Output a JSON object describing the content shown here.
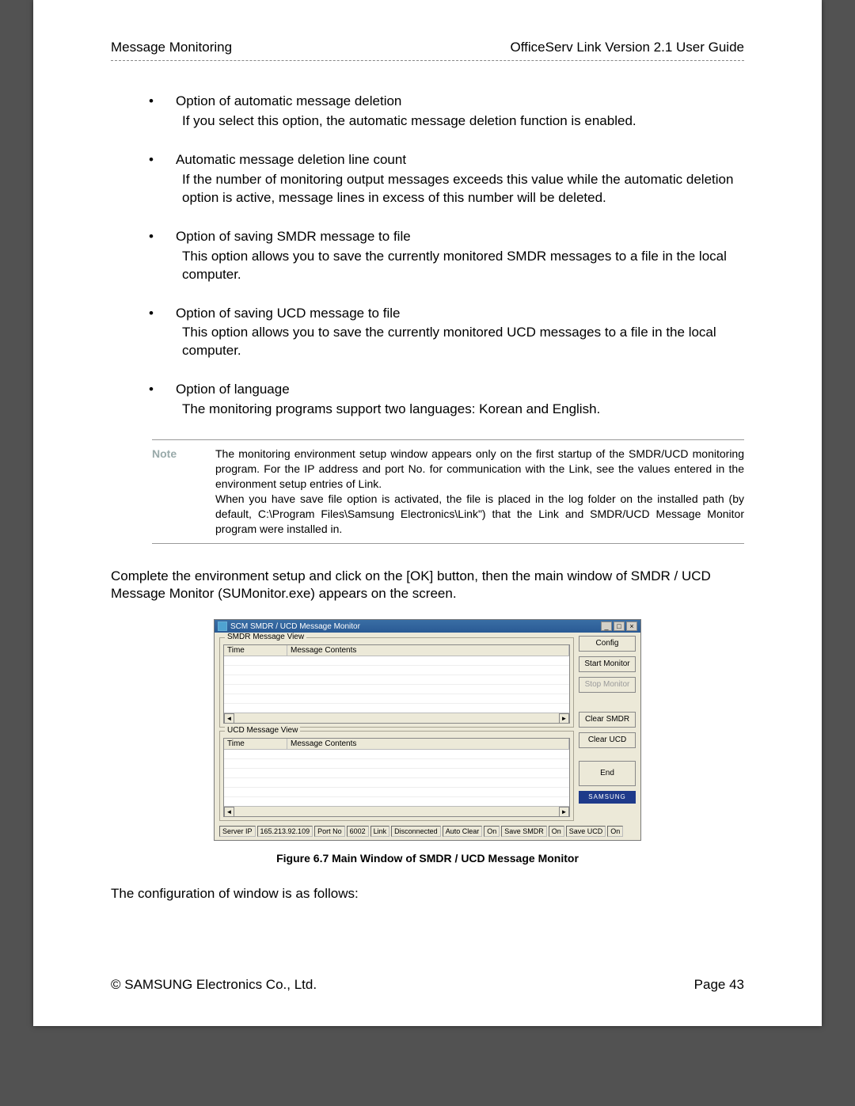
{
  "header": {
    "left": "Message Monitoring",
    "right": "OfficeServ Link Version 2.1 User Guide"
  },
  "bullets": [
    {
      "title": "Option of automatic message deletion",
      "desc": "If you select this option, the automatic message deletion function is enabled."
    },
    {
      "title": "Automatic message deletion line count",
      "desc": "If the number of monitoring output messages exceeds this value while the automatic deletion option is active, message lines in excess of this number will be deleted."
    },
    {
      "title": "Option of saving SMDR message to file",
      "desc": "This option allows you to save the currently monitored SMDR messages to a file in the local computer."
    },
    {
      "title": "Option of saving UCD message to file",
      "desc": "This option allows you to save the currently monitored UCD messages to a file in the local computer."
    },
    {
      "title": "Option of language",
      "desc": "The monitoring programs support two languages: Korean and English."
    }
  ],
  "note": {
    "label": "Note",
    "text": "The monitoring environment setup window appears only on the first startup of the SMDR/UCD monitoring program. For the IP address and port No. for communication with the Link, see the values entered in the environment setup entries of Link.\nWhen you have save file option is activated, the file is placed in the log folder on the installed path (by default, C:\\Program Files\\Samsung Electronics\\Link\") that the Link and SMDR/UCD Message Monitor program were installed in."
  },
  "para_after_note": "Complete the environment setup and click on the [OK] button, then the main window of SMDR / UCD Message Monitor (SUMonitor.exe) appears on the screen.",
  "screenshot": {
    "title": "SCM SMDR / UCD Message Monitor",
    "group_smdr": "SMDR Message View",
    "group_ucd": "UCD Message View",
    "col_time": "Time",
    "col_msg": "Message Contents",
    "buttons": {
      "config": "Config",
      "start": "Start Monitor",
      "stop": "Stop Monitor",
      "clear_smdr": "Clear SMDR",
      "clear_ucd": "Clear UCD",
      "end": "End"
    },
    "logo": "SAMSUNG",
    "status": {
      "server_ip_lbl": "Server IP",
      "server_ip": "165.213.92.109",
      "port_lbl": "Port No",
      "port": "6002",
      "link_lbl": "Link",
      "link": "Disconnected",
      "auto_lbl": "Auto Clear",
      "auto": "On",
      "ssmdr_lbl": "Save SMDR",
      "ssmdr": "On",
      "sucd_lbl": "Save UCD",
      "sucd": "On"
    }
  },
  "figcaption": "Figure 6.7 Main Window of SMDR / UCD Message Monitor",
  "para_after_fig": "The configuration of window is as follows:",
  "footer": {
    "left": "© SAMSUNG Electronics Co., Ltd.",
    "right": "Page 43"
  }
}
